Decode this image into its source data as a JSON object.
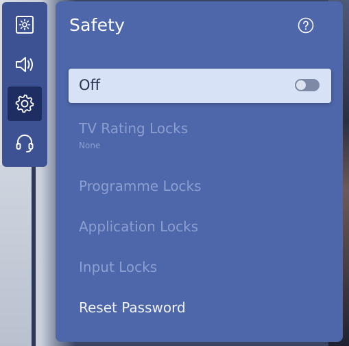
{
  "panel": {
    "title": "Safety",
    "help_icon": "help-circle-icon"
  },
  "rail": {
    "items": [
      {
        "icon": "picture-settings-icon",
        "active": false
      },
      {
        "icon": "sound-icon",
        "active": false
      },
      {
        "icon": "gear-icon",
        "active": true
      },
      {
        "icon": "headset-icon",
        "active": false
      }
    ]
  },
  "toggle": {
    "label": "Off",
    "state": false
  },
  "menu": {
    "tv_rating_locks": "TV Rating Locks",
    "tv_rating_value": "None",
    "programme_locks": "Programme Locks",
    "application_locks": "Application Locks",
    "input_locks": "Input Locks",
    "reset_password": "Reset Password"
  },
  "colors": {
    "panel": "#4e67aa",
    "rail": "#3d5292",
    "rail_active": "#1e2d62",
    "highlight_row": "#d7e2f6",
    "disabled_text": "#8c9fd0",
    "enabled_text": "#f2f4fa"
  }
}
